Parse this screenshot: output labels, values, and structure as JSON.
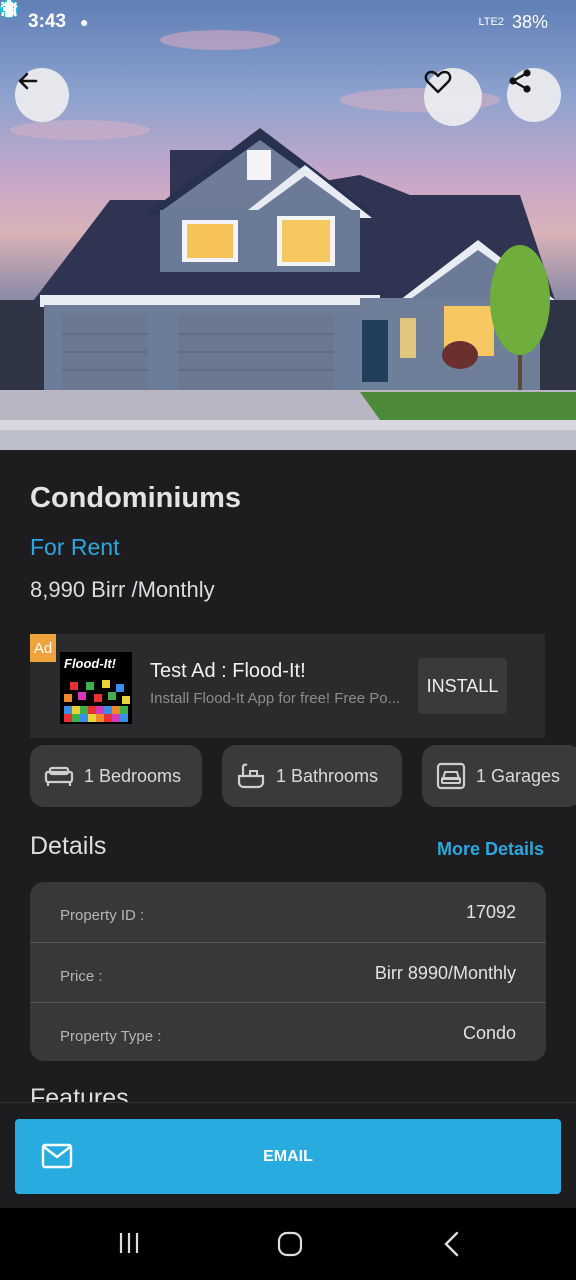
{
  "status_bar": {
    "time": "3:43",
    "battery": "38%",
    "network": "LTE2"
  },
  "hero": {
    "back_icon": "arrow-left-icon",
    "favorite_icon": "heart-icon",
    "share_icon": "share-icon"
  },
  "listing": {
    "title": "Condominiums",
    "status": "For Rent",
    "price": "8,990 Birr /Monthly"
  },
  "ad": {
    "badge": "Ad",
    "logo_text": "Flood-It!",
    "title": "Test Ad : Flood-It!",
    "description": "Install Flood-It App for free! Free Po...",
    "install_label": "INSTALL"
  },
  "features_chips": [
    {
      "label": "1 Bedrooms",
      "icon": "bed-icon"
    },
    {
      "label": "1 Bathrooms",
      "icon": "bathtub-icon"
    },
    {
      "label": "1 Garages",
      "icon": "car-icon"
    }
  ],
  "details": {
    "heading": "Details",
    "more_label": "More Details",
    "rows": [
      {
        "key": "Property ID :",
        "value": "17092"
      },
      {
        "key": "Price :",
        "value": "Birr 8990/Monthly"
      },
      {
        "key": "Property Type :",
        "value": "Condo"
      }
    ]
  },
  "features_heading": "Features",
  "actions": {
    "email_label": "EMAIL",
    "email_icon": "mail-icon"
  },
  "colors": {
    "accent": "#2ba7e0",
    "background": "#1d1d1f",
    "card": "#38383a",
    "ad_badge": "#f0a23c"
  }
}
